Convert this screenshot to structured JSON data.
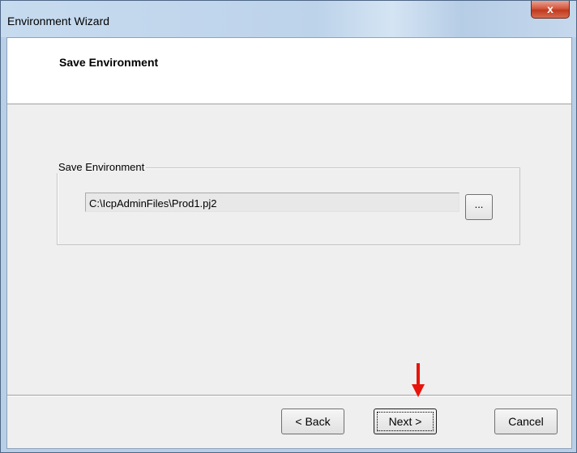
{
  "window": {
    "title": "Environment Wizard",
    "close_symbol": "x"
  },
  "header": {
    "title": "Save Environment"
  },
  "group": {
    "legend": "Save Environment",
    "path_value": "C:\\IcpAdminFiles\\Prod1.pj2",
    "browse_label": "..."
  },
  "buttons": {
    "back": "< Back",
    "next": "Next >",
    "cancel": "Cancel"
  },
  "annotation": {
    "icon": "down-arrow-icon",
    "color": "#e8140c"
  }
}
